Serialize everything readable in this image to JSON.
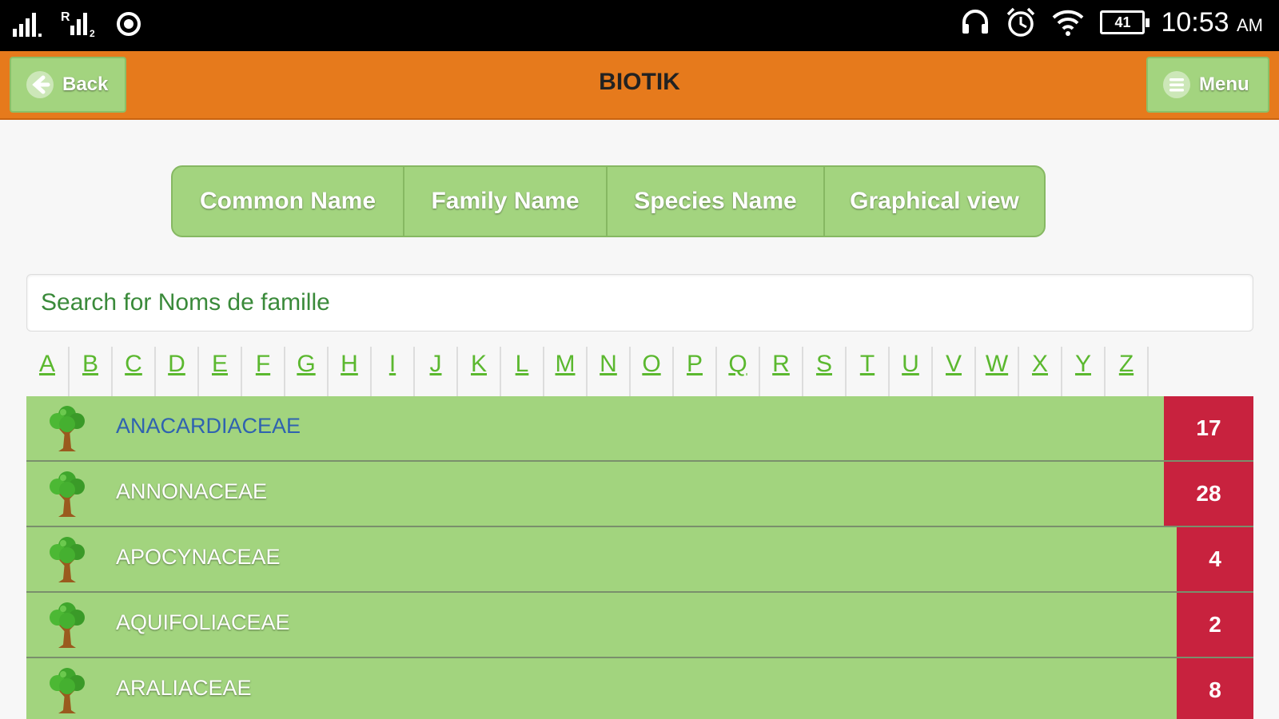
{
  "status_bar": {
    "time": "10:53",
    "ampm": "AM",
    "battery": "41"
  },
  "header": {
    "back_label": "Back",
    "title": "BIOTIK",
    "menu_label": "Menu"
  },
  "tabs": [
    {
      "label": "Common Name"
    },
    {
      "label": "Family Name"
    },
    {
      "label": "Species Name"
    },
    {
      "label": "Graphical view"
    }
  ],
  "search": {
    "placeholder": "Search for Noms de famille"
  },
  "alphabet": [
    "A",
    "B",
    "C",
    "D",
    "E",
    "F",
    "G",
    "H",
    "I",
    "J",
    "K",
    "L",
    "M",
    "N",
    "O",
    "P",
    "Q",
    "R",
    "S",
    "T",
    "U",
    "V",
    "W",
    "X",
    "Y",
    "Z"
  ],
  "families": [
    {
      "name": "ANACARDIACEAE",
      "count": "17"
    },
    {
      "name": "ANNONACEAE",
      "count": "28"
    },
    {
      "name": "APOCYNACEAE",
      "count": "4"
    },
    {
      "name": "AQUIFOLIACEAE",
      "count": "2"
    },
    {
      "name": "ARALIACEAE",
      "count": "8"
    }
  ],
  "colors": {
    "header": "#e67a1c",
    "button_green": "#a3d47f",
    "count_red": "#c8223e",
    "letter_green": "#5bb82f"
  }
}
